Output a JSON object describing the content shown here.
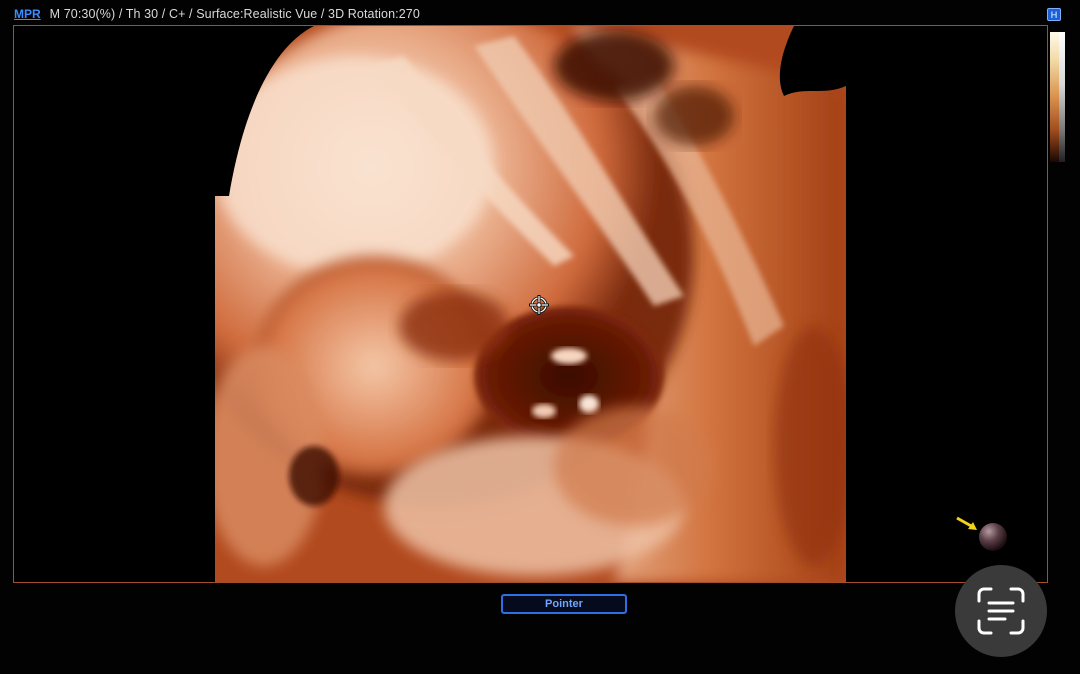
{
  "header": {
    "mode_tab": "MPR",
    "parameters": "M 70:30(%) / Th 30 / C+ / Surface:Realistic Vue / 3D Rotation:270",
    "corner_indicator": "H"
  },
  "footer": {
    "pointer_button": "Pointer"
  },
  "icons": {
    "crosshair": "crosshair-target-icon",
    "orientation": "orientation-ball-icon",
    "scan": "document-scan-icon"
  },
  "colors": {
    "accent_blue": "#2f6fe3",
    "viewport_border": "#a54e2e",
    "render_dark": "#5a1606",
    "render_mid": "#c4562a",
    "render_light": "#f1cdb1"
  }
}
